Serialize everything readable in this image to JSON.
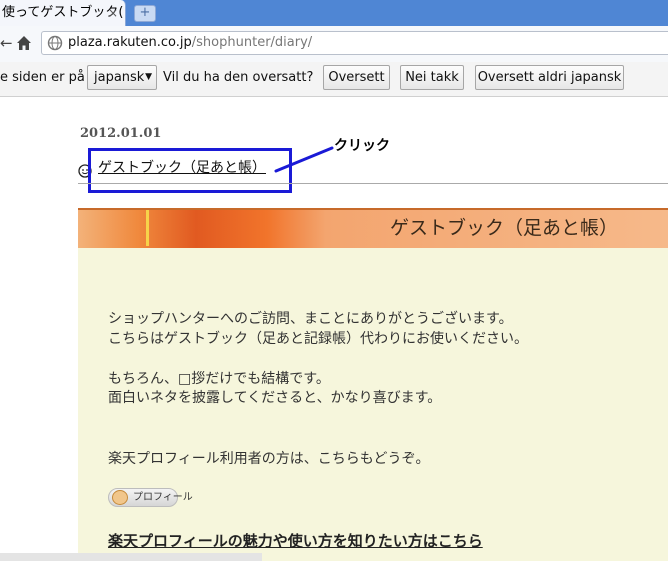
{
  "browser": {
    "tab_title": "使ってゲストブック(",
    "tab_close": "×",
    "new_tab": "+",
    "back": "←",
    "url_host": "plaza.rakuten.co.jp",
    "url_path": "/shophunter/diary/"
  },
  "translate_bar": {
    "prefix": "e siden er på",
    "language": "japansk",
    "question": "Vil du ha den oversatt?",
    "translate_button": "Oversett",
    "no_button": "Nei takk",
    "never_button": "Oversett aldri japansk"
  },
  "entry": {
    "date": "2012.01.01",
    "title_link": "ゲストブック（足あと帳）"
  },
  "annotation": {
    "label": "クリック",
    "box_color": "#1a1ad6"
  },
  "guestbook": {
    "banner_title": "ゲストブック（足あと帳）",
    "lines": [
      "ショップハンターへのご訪問、まことにありがとうございます。",
      "こちらはゲストブック（足あと記録帳）代わりにお使いください。",
      "もちろん、□拶だけでも結構です。",
      "面白いネタを披露してくださると、かなり喜びます。",
      "楽天プロフィール利用者の方は、こちらもどうぞ。"
    ],
    "profile_button": "プロフィール",
    "profile_link": "楽天プロフィールの魅力や使い方を知りたい方はこちら"
  }
}
